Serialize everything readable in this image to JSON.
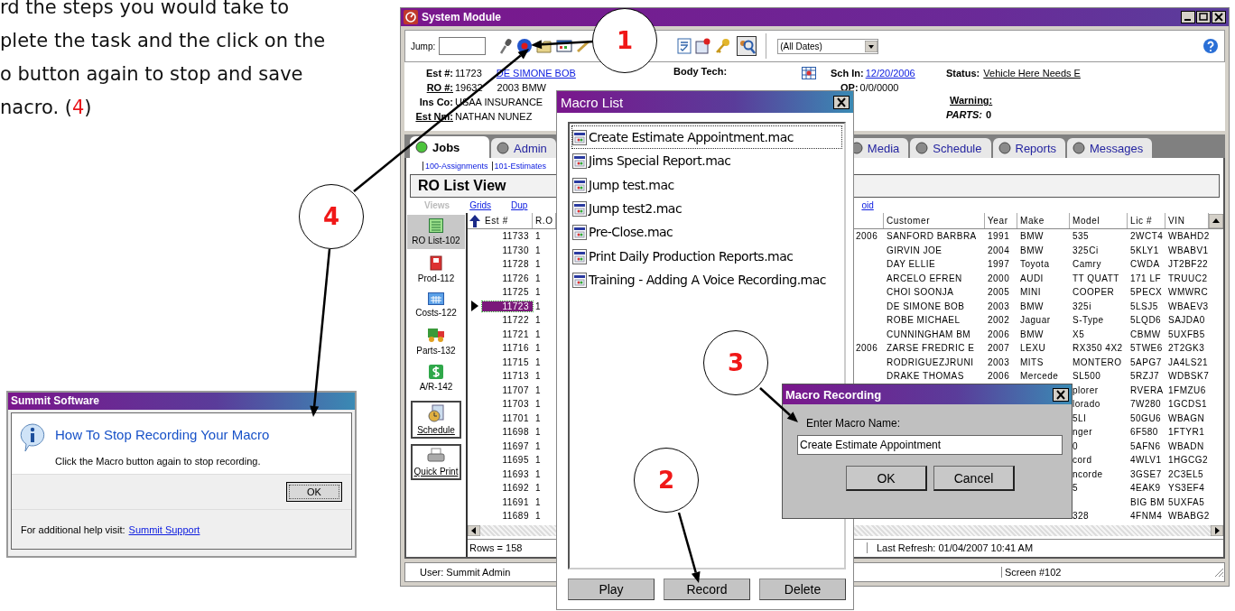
{
  "instructions": {
    "lines": [
      "rd the steps you would take to",
      "plete the task and the click on the",
      "o button again to stop and save",
      "nacro. ("
    ],
    "step_ref": "4",
    "closing": ")"
  },
  "help_dialog": {
    "title": "Summit Software",
    "heading": "How To Stop Recording Your Macro",
    "message": "Click the Macro button again to stop recording.",
    "ok": "OK",
    "footer": "For additional help visit:",
    "link": "Summit Support"
  },
  "main_window": {
    "title": "System Module",
    "toolbar": {
      "jump_label": "Jump:",
      "date_filter": "(All Dates)"
    },
    "info": {
      "est_label": "Est #:",
      "est": "11723",
      "customer": "DE SIMONE BOB",
      "ro_label": "RO #:",
      "ro": "19632",
      "vehicle": "2003 BMW",
      "ins_label": "Ins Co:",
      "ins": "USAA INSURANCE",
      "estimator_label": "Est Nm:",
      "estimator": "NATHAN NUNEZ",
      "body_tech_label": "Body Tech:",
      "sch_in_label": "Sch In:",
      "sch_in": "12/20/2006",
      "op_label": "OP:",
      "op": "0/0/0000",
      "status_label": "Status:",
      "status": "Vehicle Here Needs E",
      "warning_label": "Warning:",
      "parts_label": "PARTS:",
      "parts": "0"
    },
    "tabs": [
      {
        "label": "Jobs",
        "selected": true
      },
      {
        "label": "Admin",
        "selected": false
      },
      {
        "label": "Media",
        "selected": false
      },
      {
        "label": "Schedule",
        "selected": false
      },
      {
        "label": "Reports",
        "selected": false
      },
      {
        "label": "Messages",
        "selected": false
      }
    ],
    "subtabs": [
      "100-Assignments",
      "101-Estimates"
    ],
    "view_title": "RO List View",
    "links": [
      {
        "label": "Views",
        "disabled": true
      },
      {
        "label": "Grids",
        "disabled": false
      },
      {
        "label": "Dup",
        "disabled": false
      },
      {
        "label": "oid",
        "disabled": false
      }
    ],
    "sidebar": [
      {
        "label": "RO List-102",
        "kind": "view",
        "selected": true
      },
      {
        "label": "Prod-112",
        "kind": "view",
        "selected": false
      },
      {
        "label": "Costs-122",
        "kind": "view",
        "selected": false
      },
      {
        "label": "Parts-132",
        "kind": "view",
        "selected": false
      },
      {
        "label": "A/R-142",
        "kind": "view",
        "selected": false
      },
      {
        "label": "Schedule",
        "kind": "button",
        "selected": false
      },
      {
        "label": "Quick Print",
        "kind": "button",
        "selected": false
      }
    ],
    "table": {
      "columns": [
        "Est #",
        "R.O",
        "Customer",
        "Year",
        "Make",
        "Model",
        "Lic #",
        "VIN"
      ],
      "rows": [
        {
          "est": "11733",
          "ro": "1",
          "column_3": "2006",
          "customer": "SANFORD BARBRA",
          "year": "1991",
          "make": "BMW",
          "model": "535",
          "lic": "2WCT4",
          "vin": "WBAHD2",
          "selected": false
        },
        {
          "est": "11730",
          "ro": "1",
          "customer": "GIRVIN JOE",
          "year": "2004",
          "make": "BMW",
          "model": "325Ci",
          "lic": "5KLY1",
          "vin": "WBABV1",
          "selected": false
        },
        {
          "est": "11728",
          "ro": "1",
          "customer": "DAY ELLIE",
          "year": "1997",
          "make": "Toyota",
          "model": "Camry",
          "lic": "CWDA",
          "vin": "JT2BF22",
          "selected": false
        },
        {
          "est": "11726",
          "ro": "1",
          "customer": "ARCELO EFREN",
          "year": "2000",
          "make": "AUDI",
          "model": "TT QUATT",
          "lic": "171 LF",
          "vin": "TRUUC2",
          "selected": false
        },
        {
          "est": "11725",
          "ro": "1",
          "customer": "CHOI SOONJA",
          "year": "2005",
          "make": "MINI",
          "model": "COOPER",
          "lic": "5PECX",
          "vin": "WMWRC",
          "selected": false
        },
        {
          "est": "11723",
          "ro": "1",
          "customer": "DE SIMONE BOB",
          "year": "2003",
          "make": "BMW",
          "model": "325i",
          "lic": "5LSJ5",
          "vin": "WBAEV3",
          "selected": true
        },
        {
          "est": "11722",
          "ro": "1",
          "customer": "ROBE MICHAEL",
          "year": "2002",
          "make": "Jaguar",
          "model": "S-Type",
          "lic": "5LQD6",
          "vin": "SAJDA0",
          "selected": false
        },
        {
          "est": "11721",
          "ro": "1",
          "customer": "CUNNINGHAM BM",
          "year": "2006",
          "make": "BMW",
          "model": "X5",
          "lic": "CBMW",
          "vin": "5UXFB5",
          "selected": false
        },
        {
          "est": "11716",
          "ro": "1",
          "column_3": "2006",
          "customer": "ZARSE FREDRIC E",
          "year": "2007",
          "make": "LEXU",
          "model": "RX350 4X2",
          "lic": "5TWE6",
          "vin": "2T2GK3",
          "selected": false
        },
        {
          "est": "11715",
          "ro": "1",
          "customer": "RODRIGUEZJRUNI",
          "year": "2003",
          "make": "MITS",
          "model": "MONTERO",
          "lic": "5APG7",
          "vin": "JA4LS21",
          "selected": false
        },
        {
          "est": "11713",
          "ro": "1",
          "customer": "DRAKE THOMAS",
          "year": "2006",
          "make": "Mercede",
          "model": "SL500",
          "lic": "5RZJ7",
          "vin": "WDBSK7",
          "selected": false
        },
        {
          "est": "11707",
          "ro": "1",
          "model": "plorer",
          "lic": "RVERA",
          "vin": "1FMZU6",
          "selected": false
        },
        {
          "est": "11703",
          "ro": "1",
          "model": "lorado",
          "lic": "7W280",
          "vin": "1GCDS1",
          "selected": false
        },
        {
          "est": "11701",
          "ro": "1",
          "model": "5LI",
          "lic": "50GU6",
          "vin": "WBAGN",
          "selected": false
        },
        {
          "est": "11698",
          "ro": "1",
          "model": "nger",
          "lic": "6F580",
          "vin": "1FTYR1",
          "selected": false
        },
        {
          "est": "11697",
          "ro": "1",
          "model": "0",
          "lic": "5AFN6",
          "vin": "WBADN",
          "selected": false
        },
        {
          "est": "11695",
          "ro": "1",
          "model": "cord",
          "lic": "4WLV1",
          "vin": "1HGCG2",
          "selected": false
        },
        {
          "est": "11693",
          "ro": "1",
          "model": "ncorde",
          "lic": "3GSE7",
          "vin": "2C3EL5",
          "selected": false
        },
        {
          "est": "11692",
          "ro": "1",
          "model": "5",
          "lic": "4EAK9",
          "vin": "YS3EF4",
          "selected": false
        },
        {
          "est": "11691",
          "ro": "1",
          "lic": "BIG BM",
          "vin": "5UXFA5",
          "selected": false
        },
        {
          "est": "11689",
          "ro": "1",
          "model": "328",
          "lic": "4FNM4",
          "vin": "WBABG2",
          "selected": false
        }
      ]
    },
    "rows_count": "Rows = 158",
    "last_refresh": "Last Refresh: 01/04/2007 10:41 AM",
    "status_bar": [
      "User: Summit Admin",
      "Screen #102"
    ]
  },
  "macro_list": {
    "title": "Macro List",
    "items": [
      {
        "name": "Create Estimate Appointment.mac",
        "focused": true
      },
      {
        "name": "Jims Special Report.mac",
        "focused": false
      },
      {
        "name": "Jump test.mac",
        "focused": false
      },
      {
        "name": "Jump test2.mac",
        "focused": false
      },
      {
        "name": "Pre-Close.mac",
        "focused": false
      },
      {
        "name": "Print Daily Production Reports.mac",
        "focused": false
      },
      {
        "name": "Training - Adding A Voice Recording.mac",
        "focused": false
      }
    ],
    "buttons": [
      "Play",
      "Record",
      "Delete"
    ]
  },
  "macro_recording": {
    "title": "Macro Recording",
    "label": "Enter Macro Name:",
    "value": "Create Estimate Appointment",
    "buttons": [
      "OK",
      "Cancel"
    ]
  },
  "callouts": [
    "1",
    "2",
    "3",
    "4"
  ]
}
